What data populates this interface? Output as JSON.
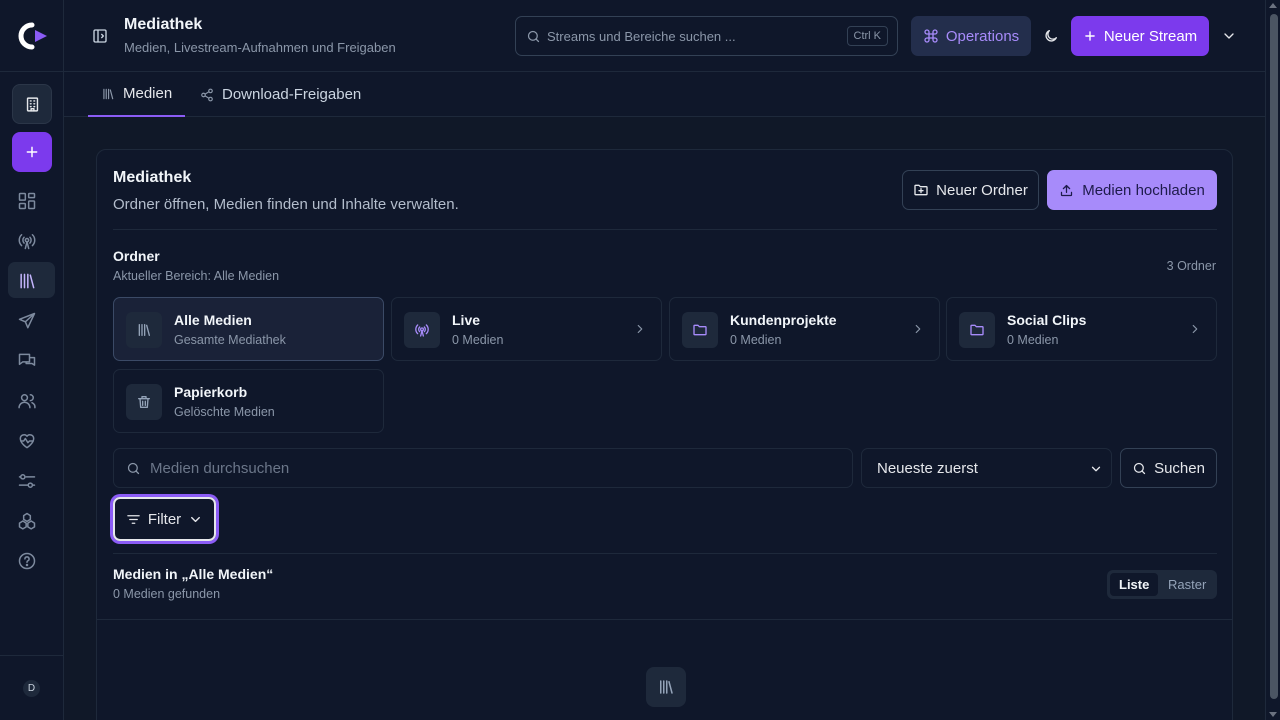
{
  "header": {
    "title": "Mediathek",
    "subtitle": "Medien, Livestream-Aufnahmen und Freigaben",
    "search_placeholder": "Streams und Bereiche suchen ...",
    "search_shortcut": "Ctrl K",
    "operations_label": "Operations",
    "new_stream_label": "Neuer Stream"
  },
  "sidebar": {
    "items": [
      {
        "icon": "building-icon"
      },
      {
        "icon": "plus-icon"
      },
      {
        "icon": "dashboard-icon"
      },
      {
        "icon": "broadcast-icon"
      },
      {
        "icon": "library-icon",
        "active": true
      },
      {
        "icon": "send-icon"
      },
      {
        "icon": "chat-icon"
      },
      {
        "icon": "users-icon"
      },
      {
        "icon": "heart-pulse-icon"
      },
      {
        "icon": "sliders-icon"
      },
      {
        "icon": "integrations-icon"
      },
      {
        "icon": "help-icon"
      }
    ],
    "avatar_initial": "D"
  },
  "tabs": [
    {
      "label": "Medien",
      "icon": "library-icon",
      "active": true
    },
    {
      "label": "Download-Freigaben",
      "icon": "share-icon",
      "active": false
    }
  ],
  "card": {
    "title": "Mediathek",
    "description": "Ordner öffnen, Medien finden und Inhalte verwalten.",
    "new_folder_label": "Neuer Ordner",
    "upload_label": "Medien hochladen"
  },
  "folders_section": {
    "title": "Ordner",
    "subtitle": "Aktueller Bereich: Alle Medien",
    "count": "3 Ordner",
    "folders": [
      {
        "name": "Alle Medien",
        "meta": "Gesamte Mediathek",
        "icon": "library-icon",
        "active": true
      },
      {
        "name": "Live",
        "meta": "0 Medien",
        "icon": "broadcast-icon"
      },
      {
        "name": "Kundenprojekte",
        "meta": "0 Medien",
        "icon": "folder-icon"
      },
      {
        "name": "Social Clips",
        "meta": "0 Medien",
        "icon": "folder-icon"
      },
      {
        "name": "Papierkorb",
        "meta": "Gelöschte Medien",
        "icon": "trash-icon"
      }
    ]
  },
  "toolbar": {
    "search_placeholder": "Medien durchsuchen",
    "sort_value": "Neueste zuerst",
    "search_button": "Suchen",
    "filter_button": "Filter"
  },
  "media_section": {
    "title": "Medien in „Alle Medien“",
    "subtitle": "0 Medien gefunden",
    "view_list": "Liste",
    "view_grid": "Raster",
    "active_view": "Liste"
  },
  "colors": {
    "accent": "#7c3aed",
    "accent_light": "#a78bfa",
    "background": "#101828",
    "surface": "#0f172a"
  }
}
